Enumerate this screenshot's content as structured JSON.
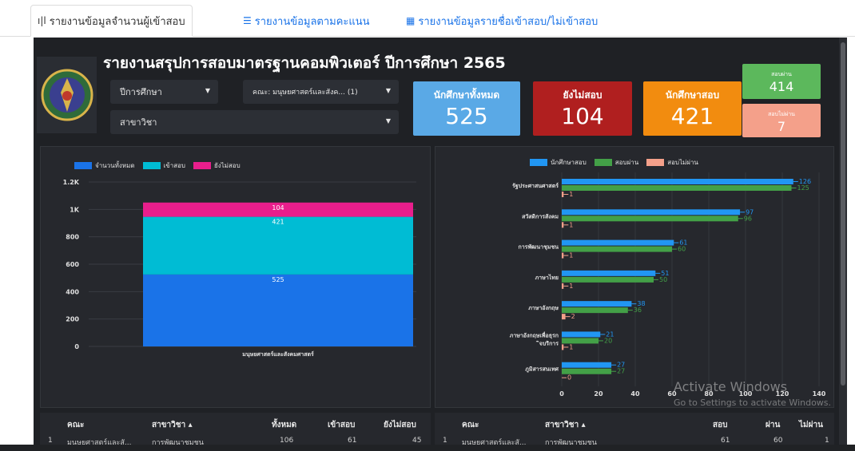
{
  "tabs": [
    {
      "icon": "bar-chart-icon",
      "label": "รายงานข้อมูลจำนวนผู้เข้าสอบ",
      "active": true
    },
    {
      "icon": "list-icon",
      "label": "รายงานข้อมูลตามคะแนน",
      "active": false
    },
    {
      "icon": "table-icon",
      "label": "รายงานข้อมูลรายชื่อเข้าสอบ/ไม่เข้าสอบ",
      "active": false
    }
  ],
  "header": {
    "title": "รายงานสรุปการสอบมาตรฐานคอมพิวเตอร์ ปีการศึกษา 2565"
  },
  "filters": {
    "year_label": "ปีการศึกษา",
    "faculty_label": "คณะ: มนุษยศาสตร์และสังค... (1)",
    "major_label": "สาขาวิชา"
  },
  "cards": {
    "total": {
      "label": "นักศึกษาทั้งหมด",
      "value": "525",
      "color": "#5aa9e6"
    },
    "not_taken": {
      "label": "ยังไม่สอบ",
      "value": "104",
      "color": "#b01f1f"
    },
    "taken": {
      "label": "นักศึกษาสอบ",
      "value": "421",
      "color": "#f28c0f"
    },
    "passed": {
      "label": "สอบผ่าน",
      "value": "414",
      "color": "#5cb85c"
    },
    "failed": {
      "label": "สอบไม่ผ่าน",
      "value": "7",
      "color": "#f4a08a"
    }
  },
  "chart_data": [
    {
      "type": "bar",
      "stacked": true,
      "categories": [
        "มนุษยศาสตร์และสังคมศาสตร์"
      ],
      "series": [
        {
          "name": "จำนวนทั้งหมด",
          "values": [
            525
          ],
          "color": "#1a73e8"
        },
        {
          "name": "เข้าสอบ",
          "values": [
            421
          ],
          "color": "#00bcd4"
        },
        {
          "name": "ยังไม่สอบ",
          "values": [
            104
          ],
          "color": "#e91e8c"
        }
      ],
      "ylim": [
        0,
        1200
      ],
      "yticks": [
        "0",
        "200",
        "400",
        "600",
        "800",
        "1K",
        "1.2K"
      ],
      "legend": "top-left"
    },
    {
      "type": "bar",
      "orientation": "horizontal",
      "categories": [
        "รัฐประศาสนศาสตร์",
        "สวัสดิการสังคม",
        "การพัฒนาชุมชน",
        "ภาษาไทย",
        "ภาษาอังกฤษ",
        "ภาษาอังกฤษเพื่อธุรกิจบริการ",
        "ภูมิสารสนเทศ"
      ],
      "series": [
        {
          "name": "นักศึกษาสอบ",
          "values": [
            126,
            97,
            61,
            51,
            38,
            21,
            27
          ],
          "color": "#2196f3"
        },
        {
          "name": "สอบผ่าน",
          "values": [
            125,
            96,
            60,
            50,
            36,
            20,
            27
          ],
          "color": "#43a047"
        },
        {
          "name": "สอบไม่ผ่าน",
          "values": [
            1,
            1,
            1,
            1,
            2,
            1,
            0
          ],
          "color": "#f4a08a"
        }
      ],
      "xlim": [
        0,
        140
      ],
      "xticks": [
        "0",
        "20",
        "40",
        "60",
        "80",
        "100",
        "120",
        "140"
      ],
      "legend": "top"
    }
  ],
  "table_left": {
    "headers": [
      "คณะ",
      "สาขาวิชา ▴",
      "ทั้งหมด",
      "เข้าสอบ",
      "ยังไม่สอบ"
    ],
    "rows": [
      [
        "1",
        "มนุษยศาสตร์และสั...",
        "การพัฒนาชุมชน",
        "106",
        "61",
        "45"
      ]
    ]
  },
  "table_right": {
    "headers": [
      "คณะ",
      "สาขาวิชา ▴",
      "สอบ",
      "ผ่าน",
      "ไม่ผ่าน"
    ],
    "rows": [
      [
        "1",
        "มนุษยศาสตร์และสั...",
        "การพัฒนาชุมชน",
        "61",
        "60",
        "1"
      ]
    ]
  },
  "watermark": {
    "line1": "Activate Windows",
    "line2": "Go to Settings to activate Windows."
  }
}
